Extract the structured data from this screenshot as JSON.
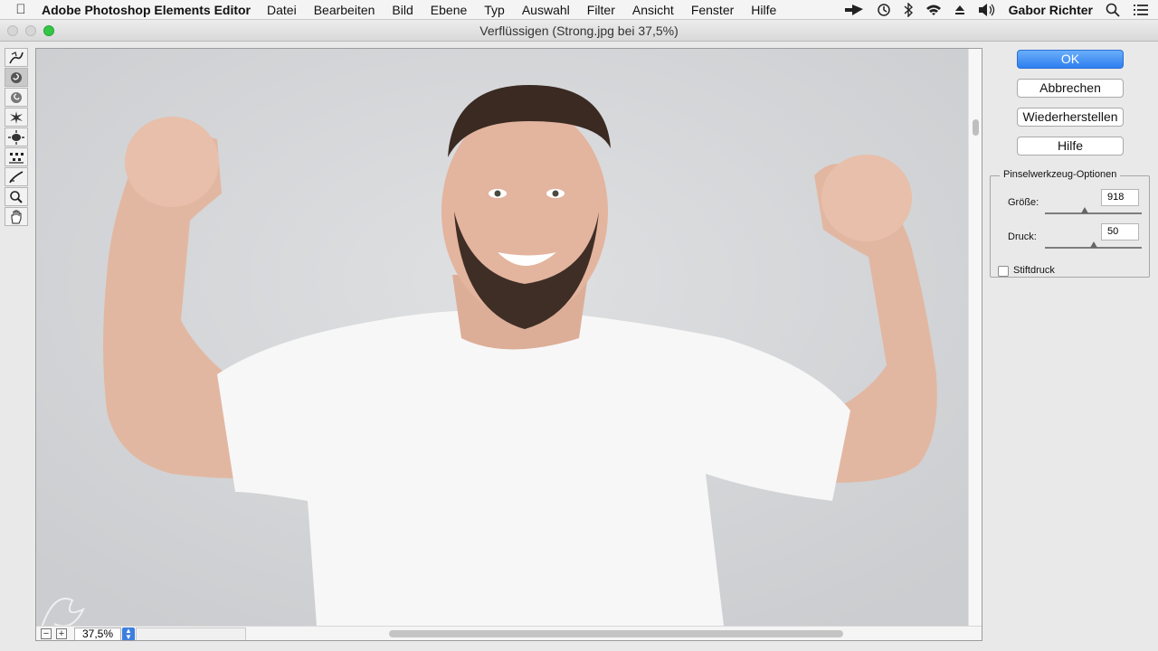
{
  "menubar": {
    "app_name": "Adobe Photoshop Elements Editor",
    "items": [
      "Datei",
      "Bearbeiten",
      "Bild",
      "Ebene",
      "Typ",
      "Auswahl",
      "Filter",
      "Ansicht",
      "Fenster",
      "Hilfe"
    ],
    "user": "Gabor Richter",
    "status_icons": [
      "cursor-arrow-icon",
      "time-machine-icon",
      "bluetooth-icon",
      "wifi-icon",
      "eject-icon",
      "volume-icon",
      "search-icon",
      "list-icon"
    ]
  },
  "window": {
    "title": "Verflüssigen (Strong.jpg bei 37,5%)"
  },
  "tools": [
    "warp-tool-icon",
    "twirl-clockwise-tool-icon",
    "twirl-counterclockwise-tool-icon",
    "pucker-tool-icon",
    "bloat-tool-icon",
    "shift-pixels-tool-icon",
    "reconstruct-tool-icon",
    "zoom-tool-icon",
    "hand-tool-icon"
  ],
  "canvas": {
    "zoom": "37,5%",
    "zoom_out": "−",
    "zoom_in": "+"
  },
  "buttons": {
    "ok": "OK",
    "cancel": "Abbrechen",
    "reset": "Wiederherstellen",
    "help": "Hilfe"
  },
  "brush_options": {
    "title": "Pinselwerkzeug-Optionen",
    "size_label": "Größe:",
    "size_value": "918",
    "pressure_label": "Druck:",
    "pressure_value": "50",
    "stylus_label": "Stiftdruck",
    "stylus_checked": false
  }
}
